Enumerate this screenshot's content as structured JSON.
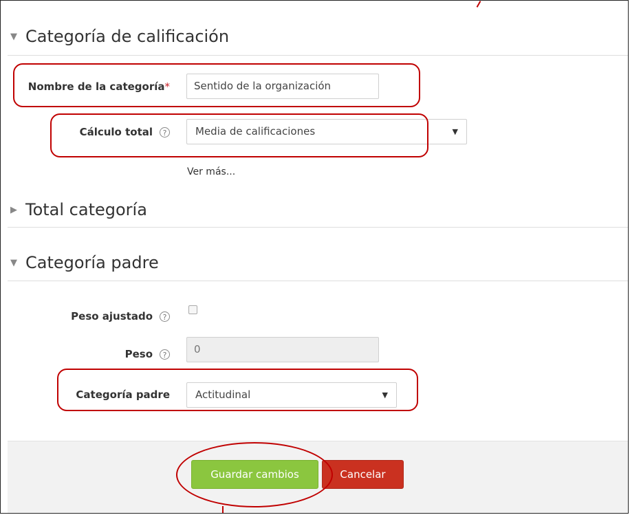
{
  "sections": {
    "grade_category": {
      "title": "Categoría de calificación",
      "expanded_icon": "triangle-down-icon"
    },
    "category_total": {
      "title": "Total categoría",
      "collapsed_icon": "triangle-right-icon"
    },
    "parent_category": {
      "title": "Categoría padre",
      "expanded_icon": "triangle-down-icon"
    }
  },
  "fields": {
    "category_name": {
      "label": "Nombre de la categoría",
      "required_mark": "*",
      "value": "Sentido de la organización"
    },
    "aggregation": {
      "label": "Cálculo total",
      "help": "?",
      "value": "Media de calificaciones"
    },
    "show_more": "Ver más...",
    "weight_adjusted": {
      "label": "Peso ajustado",
      "help": "?",
      "checked": false
    },
    "weight": {
      "label": "Peso",
      "help": "?",
      "value": "0"
    },
    "parent_category": {
      "label": "Categoría padre",
      "value": "Actitudinal"
    }
  },
  "buttons": {
    "save": "Guardar cambios",
    "cancel": "Cancelar"
  },
  "select_arrow": "▼",
  "colors": {
    "save_button": "#8bc63f",
    "cancel_button": "#ca3120",
    "annotation": "#c00000",
    "required": "#c8222a"
  }
}
